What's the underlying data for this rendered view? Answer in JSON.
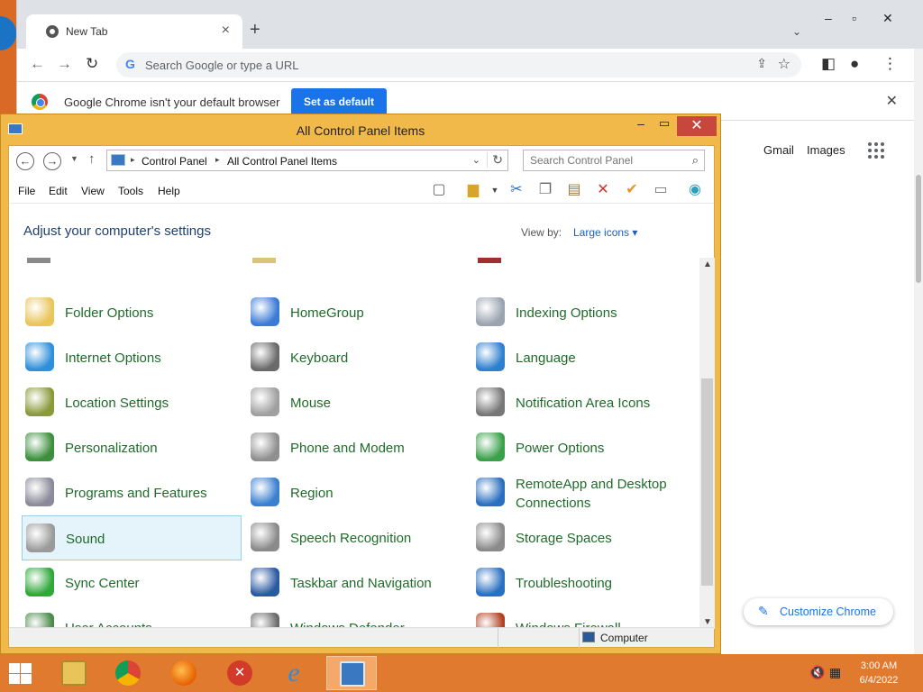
{
  "chrome": {
    "tab_title": "New Tab",
    "omnibox_placeholder": "Search Google or type a URL",
    "infobar_message": "Google Chrome isn't your default browser",
    "set_default_label": "Set as default",
    "gmail": "Gmail",
    "images": "Images",
    "customize_label": "Customize Chrome"
  },
  "cp": {
    "title": "All Control Panel Items",
    "breadcrumb": [
      "Control Panel",
      "All Control Panel Items"
    ],
    "search_placeholder": "Search Control Panel",
    "menu": [
      "File",
      "Edit",
      "View",
      "Tools",
      "Help"
    ],
    "heading": "Adjust your computer's settings",
    "view_by_label": "View by:",
    "view_by_value": "Large icons ▾",
    "selected_item": "Sound",
    "items": [
      {
        "label": "Folder Options",
        "icon": "folder-options-icon",
        "color": "#e9c55a"
      },
      {
        "label": "HomeGroup",
        "icon": "homegroup-icon",
        "color": "#3a7bd5"
      },
      {
        "label": "Indexing Options",
        "icon": "indexing-options-icon",
        "color": "#9aa4b0"
      },
      {
        "label": "Internet Options",
        "icon": "internet-options-icon",
        "color": "#2f8fd8"
      },
      {
        "label": "Keyboard",
        "icon": "keyboard-icon",
        "color": "#6a6a6a"
      },
      {
        "label": "Language",
        "icon": "language-icon",
        "color": "#2d7fcf"
      },
      {
        "label": "Location Settings",
        "icon": "location-settings-icon",
        "color": "#8a9a3a"
      },
      {
        "label": "Mouse",
        "icon": "mouse-icon",
        "color": "#a0a0a0"
      },
      {
        "label": "Notification Area Icons",
        "icon": "notification-area-icon",
        "color": "#777777"
      },
      {
        "label": "Personalization",
        "icon": "personalization-icon",
        "color": "#3c8f3c"
      },
      {
        "label": "Phone and Modem",
        "icon": "phone-modem-icon",
        "color": "#8f8f8f"
      },
      {
        "label": "Power Options",
        "icon": "power-options-icon",
        "color": "#3aa04a"
      },
      {
        "label": "Programs and Features",
        "icon": "programs-features-icon",
        "color": "#8a8a9a"
      },
      {
        "label": "Region",
        "icon": "region-icon",
        "color": "#3a7fd0"
      },
      {
        "label": "RemoteApp and Desktop Connections",
        "label_lines": [
          "RemoteApp and Desktop",
          "Connections"
        ],
        "icon": "remoteapp-icon",
        "color": "#2a6fc0"
      },
      {
        "label": "Sound",
        "icon": "sound-icon",
        "color": "#9a9a9a"
      },
      {
        "label": "Speech Recognition",
        "icon": "speech-recognition-icon",
        "color": "#8a8a8a"
      },
      {
        "label": "Storage Spaces",
        "icon": "storage-spaces-icon",
        "color": "#8a8a8a"
      },
      {
        "label": "Sync Center",
        "icon": "sync-center-icon",
        "color": "#2fa83a"
      },
      {
        "label": "Taskbar and Navigation",
        "icon": "taskbar-navigation-icon",
        "color": "#2a5aa0"
      },
      {
        "label": "Troubleshooting",
        "icon": "troubleshooting-icon",
        "color": "#2a6fc0"
      },
      {
        "label": "User Accounts",
        "icon": "user-accounts-icon",
        "color": "#4a8a4a"
      },
      {
        "label": "Windows Defender",
        "icon": "windows-defender-icon",
        "color": "#6a6a6a"
      },
      {
        "label": "Windows Firewall",
        "icon": "windows-firewall-icon",
        "color": "#b04020"
      }
    ],
    "status_computer": "Computer"
  },
  "taskbar": {
    "time": "3:00 AM",
    "date": "6/4/2022"
  }
}
